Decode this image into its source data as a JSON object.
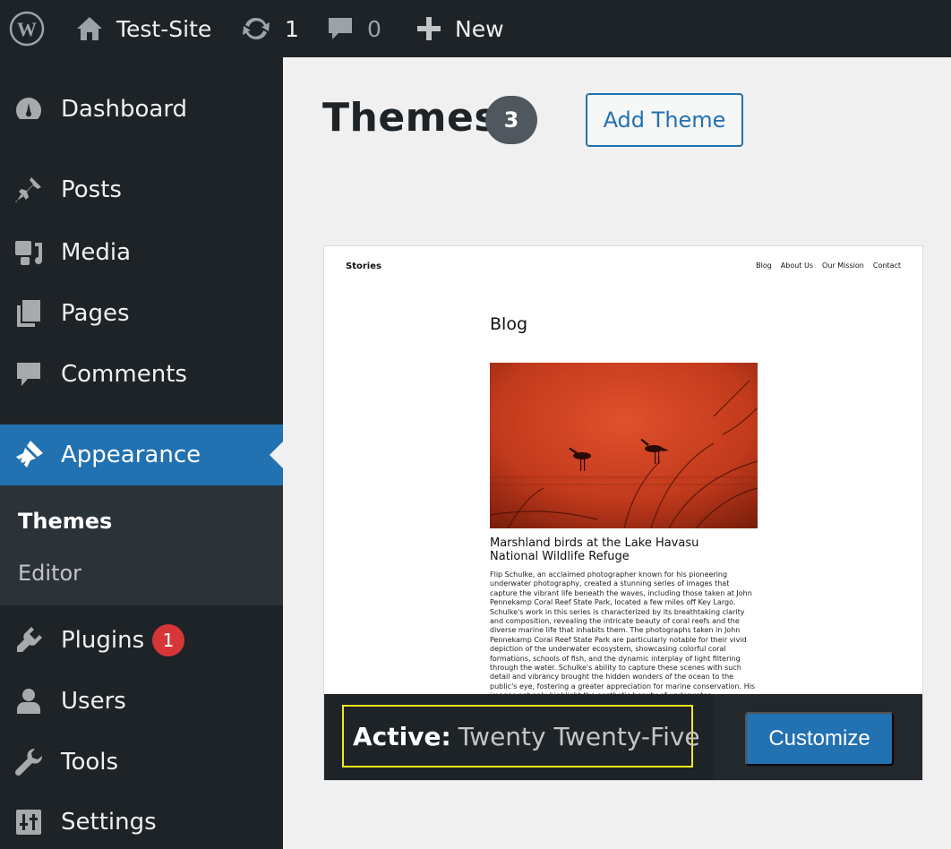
{
  "adminbar": {
    "site_name": "Test-Site",
    "updates_count": "1",
    "comments_count": "0",
    "new_label": "New"
  },
  "sidebar": {
    "items": [
      {
        "label": "Dashboard",
        "icon": "dashboard-icon"
      },
      {
        "label": "Posts",
        "icon": "pin-icon"
      },
      {
        "label": "Media",
        "icon": "media-icon"
      },
      {
        "label": "Pages",
        "icon": "pages-icon"
      },
      {
        "label": "Comments",
        "icon": "comment-icon"
      },
      {
        "label": "Appearance",
        "icon": "paintbrush-icon"
      },
      {
        "label": "Plugins",
        "icon": "plugin-icon",
        "badge": "1"
      },
      {
        "label": "Users",
        "icon": "user-icon"
      },
      {
        "label": "Tools",
        "icon": "wrench-icon"
      },
      {
        "label": "Settings",
        "icon": "settings-icon"
      }
    ],
    "submenu": [
      {
        "label": "Themes"
      },
      {
        "label": "Editor"
      }
    ]
  },
  "main": {
    "title": "Themes",
    "theme_count": "3",
    "add_theme_label": "Add Theme"
  },
  "theme": {
    "active_prefix": "Active:",
    "active_name": "Twenty Twenty-Five",
    "customize_label": "Customize",
    "preview": {
      "site_title": "Stories",
      "nav": [
        "Blog",
        "About Us",
        "Our Mission",
        "Contact"
      ],
      "heading": "Blog",
      "post_title": "Marshland birds at the Lake Havasu National Wildlife Refuge",
      "post_body": "Flip Schulke, an acclaimed photographer known for his pioneering underwater photography, created a stunning series of images that capture the vibrant life beneath the waves, including those taken at John Pennekamp Coral Reef State Park, located a few miles off Key Largo. Schulke's work in this series is characterized by its breathtaking clarity and composition, revealing the intricate beauty of coral reefs and the diverse marine life that inhabits them. The photographs taken in John Pennekamp Coral Reef State Park are particularly notable for their vivid depiction of the underwater ecosystem, showcasing colorful coral formations, schools of fish, and the dynamic interplay of light filtering through the water. Schulke's ability to capture these scenes with such detail and vibrancy brought the hidden wonders of the ocean to the public's eye, fostering a greater appreciation for marine conservation. His images not only highlight the aesthetic beauty of underwater environments but"
    }
  },
  "colors": {
    "admin_dark": "#1d2327",
    "accent": "#2271b1",
    "badge_red": "#d63638",
    "highlight": "#f2e91c"
  }
}
